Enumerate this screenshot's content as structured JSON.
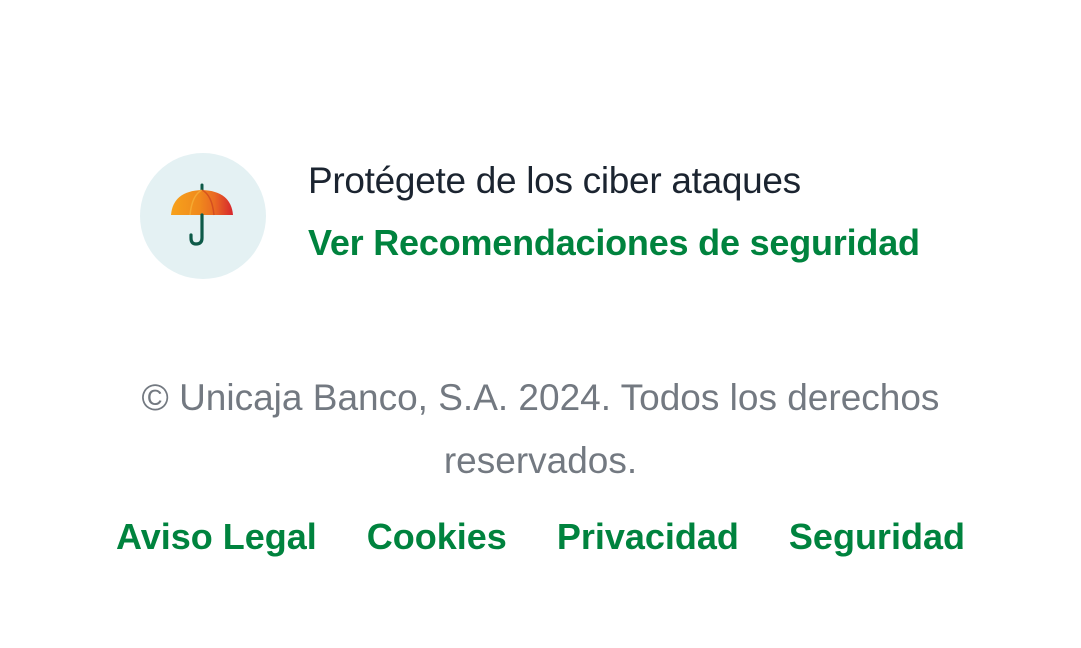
{
  "security_banner": {
    "icon": "umbrella-icon",
    "title": "Protégete de los ciber ataques",
    "link_label": "Ver Recomendaciones de seguridad"
  },
  "footer": {
    "copyright": "© Unicaja Banco, S.A. 2024. Todos los derechos reservados.",
    "links": [
      {
        "label": "Aviso Legal"
      },
      {
        "label": "Cookies"
      },
      {
        "label": "Privacidad"
      },
      {
        "label": "Seguridad"
      }
    ]
  },
  "colors": {
    "accent": "#00833e",
    "text_dark": "#1b2430",
    "text_muted": "#737981",
    "icon_bg": "#e4f1f3"
  }
}
